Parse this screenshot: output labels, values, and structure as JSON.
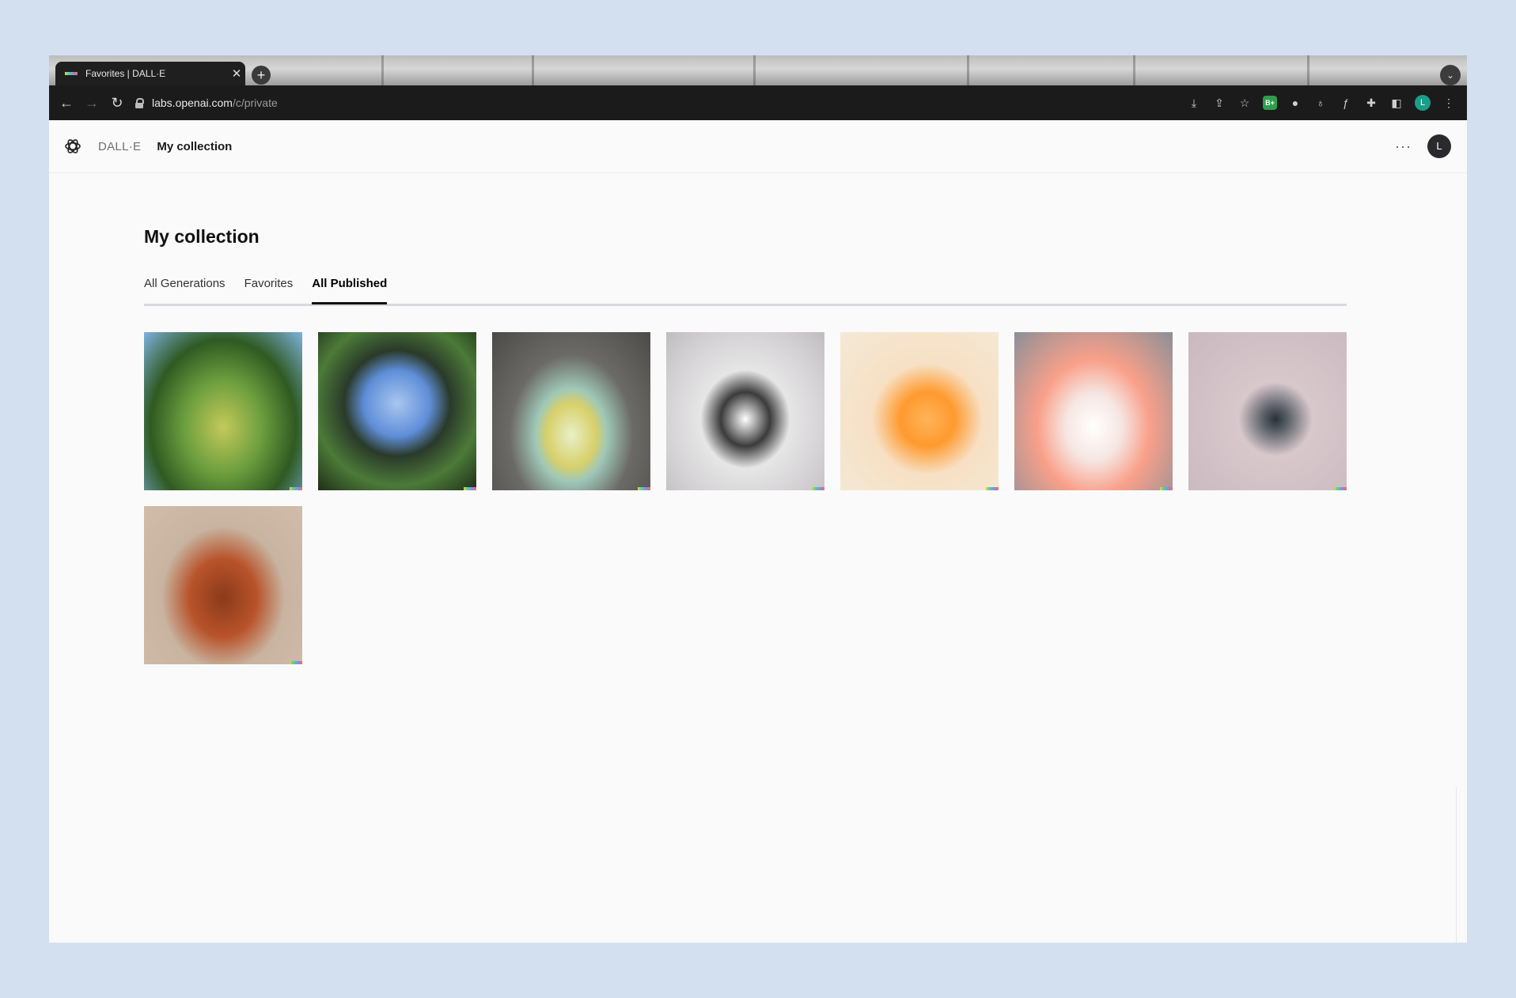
{
  "browser": {
    "tab_title": "Favorites | DALL·E",
    "tab_close": "✕",
    "new_tab": "+",
    "tab_search": "⌄",
    "url_host": "labs.openai.com",
    "url_path": "/c/private",
    "back": "←",
    "forward": "→",
    "reload": "↻",
    "extensions": [
      {
        "name": "install-icon",
        "glyph": "⤓"
      },
      {
        "name": "share-icon",
        "glyph": "⇪"
      },
      {
        "name": "bookmark-star-icon",
        "glyph": "☆"
      },
      {
        "name": "extension-green-icon",
        "glyph": "B+"
      },
      {
        "name": "extension-gray-icon",
        "glyph": "●"
      },
      {
        "name": "extension-bulb-icon",
        "glyph": "♁"
      },
      {
        "name": "extension-formula-icon",
        "glyph": "ƒ"
      },
      {
        "name": "puzzle-icon",
        "glyph": "✚"
      },
      {
        "name": "sidepanel-icon",
        "glyph": "◧"
      }
    ],
    "profile_initial": "L",
    "menu": "⋮"
  },
  "header": {
    "brand": "DALL·E",
    "crumb": "My collection",
    "more": "···",
    "avatar_initial": "L"
  },
  "page": {
    "title": "My collection",
    "tabs": [
      {
        "label": "All Generations",
        "active": false
      },
      {
        "label": "Favorites",
        "active": false
      },
      {
        "label": "All Published",
        "active": true
      }
    ]
  },
  "images": [
    {
      "name": "image-lily-pond-bridge"
    },
    {
      "name": "image-fisheye-pond"
    },
    {
      "name": "image-glass-cat-leaves"
    },
    {
      "name": "image-black-white-cat"
    },
    {
      "name": "image-orange-glass-cat"
    },
    {
      "name": "image-white-red-cat"
    },
    {
      "name": "image-black-cat-leaves"
    },
    {
      "name": "image-pumpkin-cat"
    }
  ]
}
